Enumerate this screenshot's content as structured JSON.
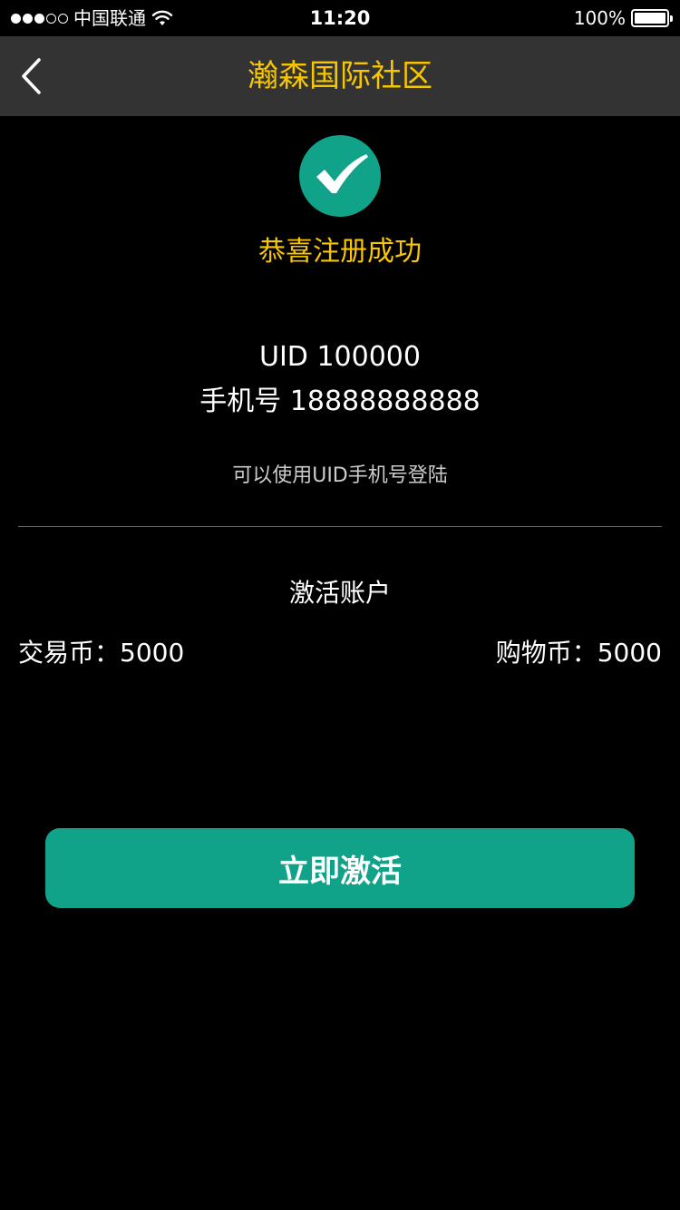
{
  "status_bar": {
    "carrier": "中国联通",
    "time": "11:20",
    "battery_percent": "100%",
    "signal_strength": 3,
    "signal_max": 5,
    "battery_level": 1.0,
    "icons": [
      "signal-icon",
      "wifi-icon",
      "battery-icon"
    ]
  },
  "nav": {
    "back_icon": "chevron-left-icon",
    "title": "瀚森国际社区"
  },
  "result": {
    "icon": "check-circle-icon",
    "message": "恭喜注册成功"
  },
  "account": {
    "uid_label": "UID",
    "uid_value": "100000",
    "phone_label": "手机号",
    "phone_value": "18888888888",
    "login_hint": "可以使用UID手机号登陆"
  },
  "activation": {
    "title": "激活账户",
    "trade_coin_label": "交易币：",
    "trade_coin_value": "5000",
    "shopping_coin_label": "购物币：",
    "shopping_coin_value": "5000",
    "button_label": "立即激活"
  },
  "colors": {
    "background": "#000000",
    "nav_background": "#333333",
    "accent_yellow": "#f7c600",
    "accent_green": "#11a38a",
    "divider": "#666666",
    "hint_text": "#cccccc"
  }
}
